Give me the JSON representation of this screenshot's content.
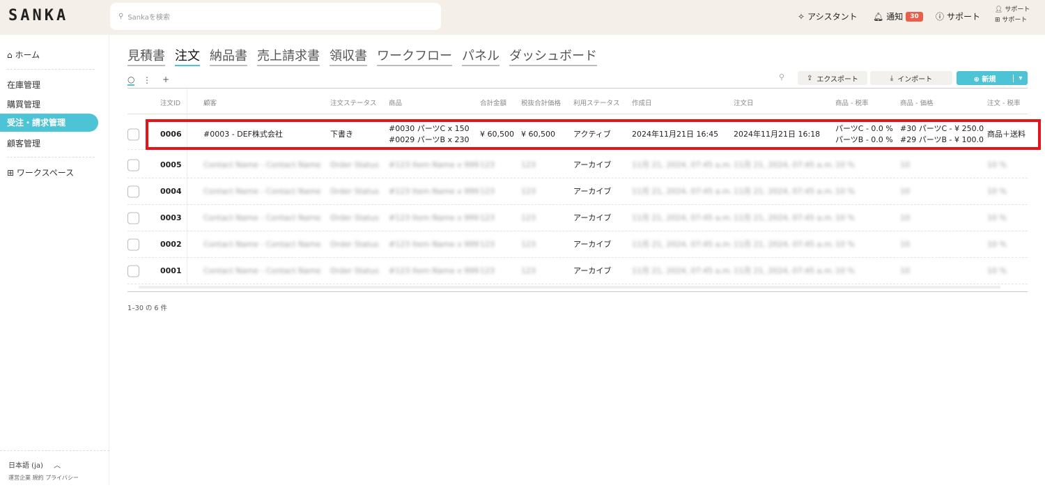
{
  "app": {
    "logo": "SANKA",
    "search_placeholder": "Sankaを検索"
  },
  "topbar": {
    "assistant": "アシスタント",
    "notify": "通知",
    "notify_count": "30",
    "support": "サポート",
    "user_line1": "サポート",
    "user_line2": "サポート"
  },
  "sidebar": {
    "home": "ホーム",
    "items": [
      "在庫管理",
      "購買管理",
      "受注・請求管理",
      "顧客管理"
    ],
    "active_index": 2,
    "workspace": "ワークスペース",
    "lang": "日本語 (ja)",
    "footer_links": "運営企業 規約 プライバシー"
  },
  "tabs": [
    {
      "label": "見積書"
    },
    {
      "label": "注文",
      "active": true
    },
    {
      "label": "納品書"
    },
    {
      "label": "売上請求書"
    },
    {
      "label": "領収書"
    },
    {
      "label": "ワークフロー"
    },
    {
      "label": "パネル"
    },
    {
      "label": "ダッシュボード"
    }
  ],
  "toolbar": {
    "export": "エクスポート",
    "import": "インポート",
    "new": "新規",
    "add": "+"
  },
  "columns": [
    "注文ID",
    "顧客",
    "注文ステータス",
    "商品",
    "合計金額",
    "税抜合計価格",
    "利用ステータス",
    "作成日",
    "注文日",
    "商品 - 税率",
    "商品 - 価格",
    "注文 - 税率"
  ],
  "rows": [
    {
      "id": "0006",
      "customer": "#0003 - DEF株式会社",
      "status": "下書き",
      "items": [
        "#0030 パーツC x 150",
        "#0029 パーツB x 230"
      ],
      "total": "¥ 60,500",
      "pretax": "¥ 60,500",
      "usage": "アクティブ",
      "created": "2024年11月21日 16:45",
      "ordered": "2024年11月21日 16:18",
      "item_tax": [
        "パーツC - 0.0 %",
        "パーツB - 0.0 %"
      ],
      "item_price": [
        "#30 パーツC - ¥ 250.0",
        "#29 パーツB - ¥ 100.0"
      ],
      "order_tax": "商品＋送料",
      "highlighted": true
    },
    {
      "id": "0005",
      "customer": "Contact Name - Contact Name",
      "status": "Order Status",
      "items": [
        "#123 Item Name x 999"
      ],
      "total": "123",
      "pretax": "123",
      "usage": "アーカイブ",
      "created": "11月 21, 2024, 07:45 a.m.",
      "ordered": "11月 21, 2024, 07:45 a.m.",
      "item_tax": [
        "10 %"
      ],
      "item_price": [
        "10"
      ],
      "order_tax": "10 %",
      "blurred": true
    },
    {
      "id": "0004",
      "customer": "Contact Name - Contact Name",
      "status": "Order Status",
      "items": [
        "#123 Item Name x 999"
      ],
      "total": "123",
      "pretax": "123",
      "usage": "アーカイブ",
      "created": "11月 21, 2024, 07:45 a.m.",
      "ordered": "11月 21, 2024, 07:45 a.m.",
      "item_tax": [
        "10 %"
      ],
      "item_price": [
        "10"
      ],
      "order_tax": "10 %",
      "blurred": true
    },
    {
      "id": "0003",
      "customer": "Contact Name - Contact Name",
      "status": "Order Status",
      "items": [
        "#123 Item Name x 999"
      ],
      "total": "123",
      "pretax": "123",
      "usage": "アーカイブ",
      "created": "11月 21, 2024, 07:45 a.m.",
      "ordered": "11月 21, 2024, 07:45 a.m.",
      "item_tax": [
        "10 %"
      ],
      "item_price": [
        "10"
      ],
      "order_tax": "10 %",
      "blurred": true
    },
    {
      "id": "0002",
      "customer": "Contact Name - Contact Name",
      "status": "Order Status",
      "items": [
        "#123 Item Name x 999"
      ],
      "total": "123",
      "pretax": "123",
      "usage": "アーカイブ",
      "created": "11月 21, 2024, 07:45 a.m.",
      "ordered": "11月 21, 2024, 07:45 a.m.",
      "item_tax": [
        "10 %"
      ],
      "item_price": [
        "10"
      ],
      "order_tax": "10 %",
      "blurred": true
    },
    {
      "id": "0001",
      "customer": "Contact Name - Contact Name",
      "status": "Order Status",
      "items": [
        "#123 Item Name x 999"
      ],
      "total": "123",
      "pretax": "123",
      "usage": "アーカイブ",
      "created": "11月 21, 2024, 07:45 a.m.",
      "ordered": "11月 21, 2024, 07:45 a.m.",
      "item_tax": [
        "10 %"
      ],
      "item_price": [
        "10"
      ],
      "order_tax": "10 %",
      "blurred": true
    }
  ],
  "pagination": "1–30 の 6 件",
  "colors": {
    "accent": "#4dc3d6",
    "badge": "#e8604c",
    "highlight": "#e5141b",
    "topbar": "#f4efe8"
  }
}
